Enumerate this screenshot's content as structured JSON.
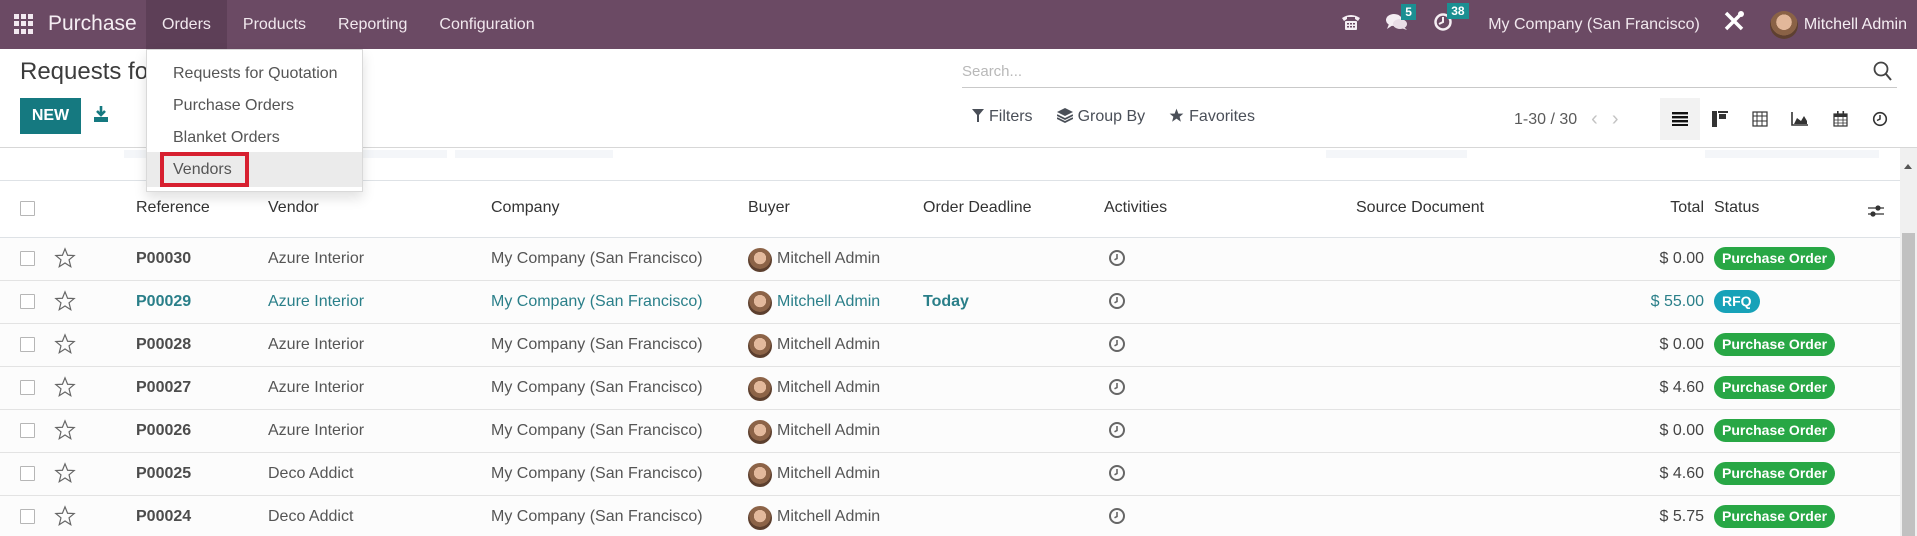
{
  "navbar": {
    "app_name": "Purchase",
    "menu": [
      "Orders",
      "Products",
      "Reporting",
      "Configuration"
    ],
    "active_menu": "Orders",
    "icons": {
      "phone": "phone-icon",
      "messages": "chat-icon",
      "activities": "clock-icon",
      "settings": "tools-icon"
    },
    "messages_count": "5",
    "activities_count": "38",
    "company": "My Company (San Francisco)",
    "user": "Mitchell Admin",
    "color": "#6b4a64"
  },
  "orders_menu": {
    "items": [
      "Requests for Quotation",
      "Purchase Orders",
      "Blanket Orders",
      "Vendors"
    ],
    "highlighted": "Vendors",
    "highlight_color": "#d72030"
  },
  "control_panel": {
    "title": "Requests for",
    "new_label": "NEW",
    "search_placeholder": "Search...",
    "filters_label": "Filters",
    "group_by_label": "Group By",
    "favorites_label": "Favorites",
    "pager": "1-30 / 30",
    "views": [
      "list",
      "kanban",
      "pivot",
      "graph",
      "calendar",
      "activity"
    ],
    "active_view": "list",
    "accent_color": "#157980"
  },
  "table": {
    "headers": {
      "reference": "Reference",
      "vendor": "Vendor",
      "company": "Company",
      "buyer": "Buyer",
      "order_deadline": "Order Deadline",
      "activities": "Activities",
      "source_document": "Source Document",
      "total": "Total",
      "status": "Status"
    },
    "rows": [
      {
        "reference": "P00030",
        "vendor": "Azure Interior",
        "company": "My Company (San Francisco)",
        "buyer": "Mitchell Admin",
        "deadline": "",
        "source": "",
        "total": "$ 0.00",
        "status": "Purchase Order"
      },
      {
        "reference": "P00029",
        "vendor": "Azure Interior",
        "company": "My Company (San Francisco)",
        "buyer": "Mitchell Admin",
        "deadline": "Today",
        "source": "",
        "total": "$ 55.00",
        "status": "RFQ"
      },
      {
        "reference": "P00028",
        "vendor": "Azure Interior",
        "company": "My Company (San Francisco)",
        "buyer": "Mitchell Admin",
        "deadline": "",
        "source": "",
        "total": "$ 0.00",
        "status": "Purchase Order"
      },
      {
        "reference": "P00027",
        "vendor": "Azure Interior",
        "company": "My Company (San Francisco)",
        "buyer": "Mitchell Admin",
        "deadline": "",
        "source": "",
        "total": "$ 4.60",
        "status": "Purchase Order"
      },
      {
        "reference": "P00026",
        "vendor": "Azure Interior",
        "company": "My Company (San Francisco)",
        "buyer": "Mitchell Admin",
        "deadline": "",
        "source": "",
        "total": "$ 0.00",
        "status": "Purchase Order"
      },
      {
        "reference": "P00025",
        "vendor": "Deco Addict",
        "company": "My Company (San Francisco)",
        "buyer": "Mitchell Admin",
        "deadline": "",
        "source": "",
        "total": "$ 4.60",
        "status": "Purchase Order"
      },
      {
        "reference": "P00024",
        "vendor": "Deco Addict",
        "company": "My Company (San Francisco)",
        "buyer": "Mitchell Admin",
        "deadline": "",
        "source": "",
        "total": "$ 5.75",
        "status": "Purchase Order"
      }
    ],
    "status_colors": {
      "Purchase Order": "#28a745",
      "RFQ": "#17a2b8"
    },
    "highlight_row_color": "#2a7f89",
    "deadline_color": "#9a7a32"
  }
}
